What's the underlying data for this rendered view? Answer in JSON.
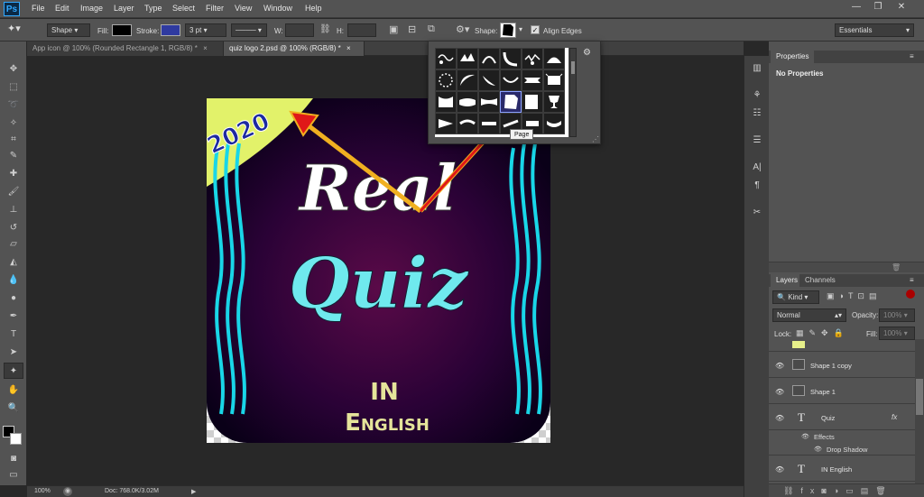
{
  "app": {
    "logo": "Ps"
  },
  "menu": [
    "File",
    "Edit",
    "Image",
    "Layer",
    "Type",
    "Select",
    "Filter",
    "View",
    "Window",
    "Help"
  ],
  "window_controls": {
    "minimize": "—",
    "restore": "❐",
    "close": "✕"
  },
  "options": {
    "mode": "Shape",
    "fill_label": "Fill:",
    "fill_color": "#000000",
    "stroke_label": "Stroke:",
    "stroke_color": "#2f3aa0",
    "stroke_width": "3 pt",
    "w_label": "W:",
    "h_label": "H:",
    "shape_label": "Shape:",
    "align_edges": "Align Edges",
    "align_edges_checked": true,
    "workspace": "Essentials"
  },
  "tabs": [
    {
      "label": "App icon @ 100% (Rounded Rectangle 1, RGB/8) *"
    },
    {
      "label": "quiz logo 2.psd @ 100% (RGB/8) *"
    }
  ],
  "artwork": {
    "year": "2020",
    "title_line1": "Real",
    "title_line2": "Quiz",
    "subtitle_line1": "IN",
    "subtitle_line2": "English",
    "bg_color": "#2a0236",
    "banner_color": "#e2f26a",
    "title_color": "#ffffff",
    "quiz_color": "#6fe9ee",
    "subtitle_color": "#e5e49a",
    "wave_color": "#19d6e8"
  },
  "shape_picker": {
    "tooltip": "Page"
  },
  "status": {
    "zoom": "100%",
    "doc": "Doc: 768.0K/3.02M"
  },
  "properties": {
    "tab": "Properties",
    "message": "No Properties"
  },
  "layers_panel": {
    "tabs": [
      "Layers",
      "Channels"
    ],
    "kind_label": "Kind",
    "blend_mode": "Normal",
    "opacity_label": "Opacity:",
    "opacity": "100%",
    "lock_label": "Lock:",
    "fill_label": "Fill:",
    "fill": "100%",
    "layers": [
      {
        "name": "Shape 1 copy",
        "type": "shape"
      },
      {
        "name": "Shape 1",
        "type": "shape"
      },
      {
        "name": "Quiz",
        "type": "text",
        "fx": "fx"
      },
      {
        "name": "IN English",
        "type": "text"
      }
    ],
    "effects_label": "Effects",
    "drop_shadow": "Drop Shadow"
  }
}
